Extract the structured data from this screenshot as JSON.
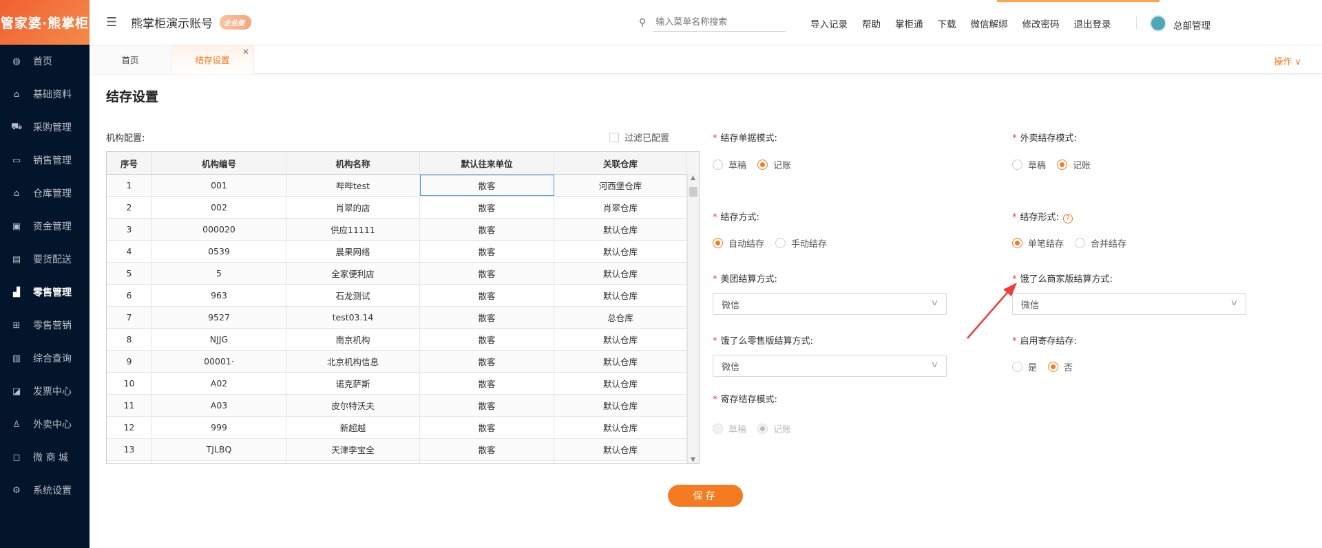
{
  "logo": "管家婆·熊掌柜",
  "sidebar": {
    "items": [
      {
        "label": "首页",
        "icon": "globe-icon",
        "glyph": "◍"
      },
      {
        "label": "基础资料",
        "icon": "home-icon",
        "glyph": "⌂"
      },
      {
        "label": "采购管理",
        "icon": "cart-icon",
        "glyph": "⛟"
      },
      {
        "label": "销售管理",
        "icon": "calendar-icon",
        "glyph": "▭"
      },
      {
        "label": "仓库管理",
        "icon": "bank-icon",
        "glyph": "⌂"
      },
      {
        "label": "资金管理",
        "icon": "money-icon",
        "glyph": "▣"
      },
      {
        "label": "要货配送",
        "icon": "list-icon",
        "glyph": "▤"
      },
      {
        "label": "零售管理",
        "icon": "chart-area-icon",
        "glyph": "▟"
      },
      {
        "label": "零售营销",
        "icon": "gift-icon",
        "glyph": "⊞"
      },
      {
        "label": "综合查询",
        "icon": "bar-chart-icon",
        "glyph": "▥"
      },
      {
        "label": "发票中心",
        "icon": "line-chart-icon",
        "glyph": "◪"
      },
      {
        "label": "外卖中心",
        "icon": "bell-icon",
        "glyph": "♙"
      },
      {
        "label": "微 商 城",
        "icon": "bag-icon",
        "glyph": "◻"
      },
      {
        "label": "系统设置",
        "icon": "gear-icon",
        "glyph": "⚙"
      }
    ],
    "active": 7
  },
  "header": {
    "account": "熊掌柜演示账号",
    "badge": "企业版",
    "search_placeholder": "输入菜单名称搜索",
    "links": [
      "导入记录",
      "帮助",
      "掌柜通",
      "下载",
      "微信解绑",
      "修改密码",
      "退出登录"
    ],
    "user": "总部管理"
  },
  "tabs": {
    "home": "首页",
    "current": "结存设置",
    "close": "×",
    "ops": "操作 ∨"
  },
  "page": {
    "title": "结存设置",
    "org_label": "机构配置:",
    "filter_label": "过滤已配置"
  },
  "table": {
    "headers": [
      "序号",
      "机构编号",
      "机构名称",
      "默认往来单位",
      "关联仓库"
    ],
    "rows": [
      [
        "1",
        "001",
        "哔哔test",
        "散客",
        "河西堡仓库"
      ],
      [
        "2",
        "002",
        "肖翠的店",
        "散客",
        "肖翠仓库"
      ],
      [
        "3",
        "000020",
        "供应11111",
        "散客",
        "默认仓库"
      ],
      [
        "4",
        "0539",
        "晨果网络",
        "散客",
        "默认仓库"
      ],
      [
        "5",
        "5",
        "全家便利店",
        "散客",
        "默认仓库"
      ],
      [
        "6",
        "963",
        "石龙测试",
        "散客",
        "默认仓库"
      ],
      [
        "7",
        "9527",
        "test03.14",
        "散客",
        "总仓库"
      ],
      [
        "8",
        "NJJG",
        "南京机构",
        "散客",
        "默认仓库"
      ],
      [
        "9",
        "00001·",
        "北京机构信息",
        "散客",
        "默认仓库"
      ],
      [
        "10",
        "A02",
        "诺克萨斯",
        "散客",
        "默认仓库"
      ],
      [
        "11",
        "A03",
        "皮尔特沃夫",
        "散客",
        "默认仓库"
      ],
      [
        "12",
        "999",
        "新超越",
        "散客",
        "默认仓库"
      ],
      [
        "13",
        "TJLBQ",
        "天津李宝全",
        "散客",
        "默认仓库"
      ]
    ]
  },
  "form": {
    "doc_mode": {
      "label": "结存单据模式:",
      "options": [
        "草稿",
        "记账"
      ],
      "selected": 1
    },
    "takeout_mode": {
      "label": "外卖结存模式:",
      "options": [
        "草稿",
        "记账"
      ],
      "selected": 1
    },
    "method": {
      "label": "结存方式:",
      "options": [
        "自动结存",
        "手动结存"
      ],
      "selected": 0
    },
    "form_type": {
      "label": "结存形式:",
      "options": [
        "单笔结存",
        "合并结存"
      ],
      "selected": 0,
      "help": "?"
    },
    "meituan": {
      "label": "美团结算方式:",
      "value": "微信"
    },
    "eleme_merchant": {
      "label": "饿了么商家版结算方式:",
      "value": "微信"
    },
    "eleme_retail": {
      "label": "饿了么零售版结算方式:",
      "value": "微信"
    },
    "consign_enable": {
      "label": "启用寄存结存:",
      "options": [
        "是",
        "否"
      ],
      "selected": 1
    },
    "consign_mode": {
      "label": "寄存结存模式:",
      "options": [
        "草稿",
        "记账"
      ],
      "selected": 1,
      "disabled": true
    },
    "save": "保存"
  },
  "colors": {
    "accent": "#f47b20",
    "sidebar": "#03152a",
    "annotation": "#f03c3c"
  }
}
